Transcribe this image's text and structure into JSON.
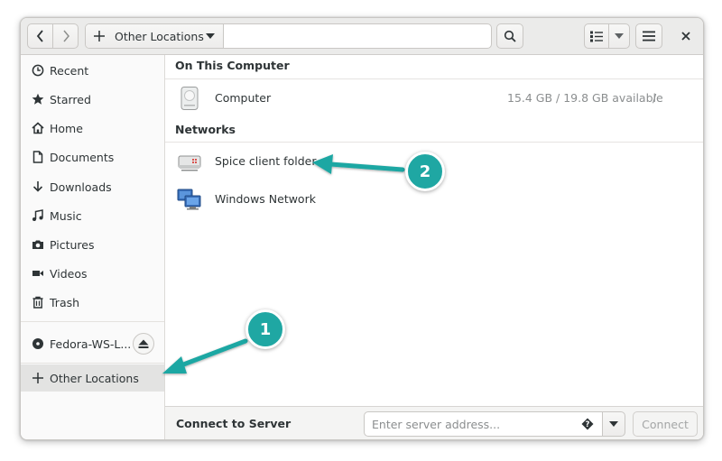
{
  "header": {
    "path_label": "Other Locations"
  },
  "sidebar": {
    "items": [
      {
        "label": "Recent",
        "icon": "clock-icon"
      },
      {
        "label": "Starred",
        "icon": "star-icon"
      },
      {
        "label": "Home",
        "icon": "home-icon"
      },
      {
        "label": "Documents",
        "icon": "document-icon"
      },
      {
        "label": "Downloads",
        "icon": "download-icon"
      },
      {
        "label": "Music",
        "icon": "music-icon"
      },
      {
        "label": "Pictures",
        "icon": "camera-icon"
      },
      {
        "label": "Videos",
        "icon": "video-icon"
      },
      {
        "label": "Trash",
        "icon": "trash-icon"
      }
    ],
    "device": {
      "label": "Fedora-WS-L...",
      "icon": "disc-icon"
    },
    "other_locations": {
      "label": "Other Locations",
      "icon": "plus-icon"
    }
  },
  "main": {
    "on_this_computer": "On This Computer",
    "computer": {
      "label": "Computer",
      "info": "15.4 GB / 19.8 GB available",
      "path": "/"
    },
    "networks": "Networks",
    "network_items": [
      {
        "label": "Spice client folder",
        "icon": "network-drive-icon"
      },
      {
        "label": "Windows Network",
        "icon": "network-workgroup-icon"
      }
    ]
  },
  "connect": {
    "label": "Connect to Server",
    "placeholder": "Enter server address...",
    "button": "Connect"
  },
  "annotations": {
    "badge1": "1",
    "badge2": "2",
    "color": "#1fa7a3"
  }
}
